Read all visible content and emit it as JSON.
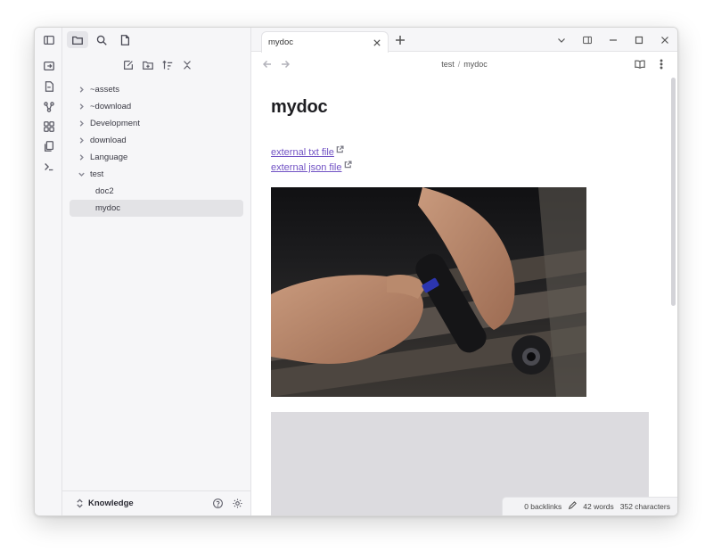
{
  "sidebar": {
    "tree": [
      {
        "label": "~assets",
        "type": "folder",
        "expanded": false
      },
      {
        "label": "~download",
        "type": "folder",
        "expanded": false
      },
      {
        "label": "Development",
        "type": "folder",
        "expanded": false
      },
      {
        "label": "download",
        "type": "folder",
        "expanded": false
      },
      {
        "label": "Language",
        "type": "folder",
        "expanded": false
      },
      {
        "label": "test",
        "type": "folder",
        "expanded": true
      },
      {
        "label": "doc2",
        "type": "file"
      },
      {
        "label": "mydoc",
        "type": "file",
        "selected": true
      }
    ],
    "vault_name": "Knowledge"
  },
  "tabs": [
    {
      "title": "mydoc",
      "active": true
    }
  ],
  "breadcrumb": {
    "folder": "test",
    "separator": "/",
    "file": "mydoc"
  },
  "document": {
    "title": "mydoc",
    "links": [
      {
        "text": "external txt file"
      },
      {
        "text": "external json file"
      }
    ]
  },
  "status": {
    "backlinks": "0 backlinks",
    "words": "42 words",
    "characters": "352 characters"
  },
  "colors": {
    "accent_link": "#7152c4",
    "sidebar_bg": "#f6f6f8",
    "selected_bg": "#e3e3e6"
  }
}
